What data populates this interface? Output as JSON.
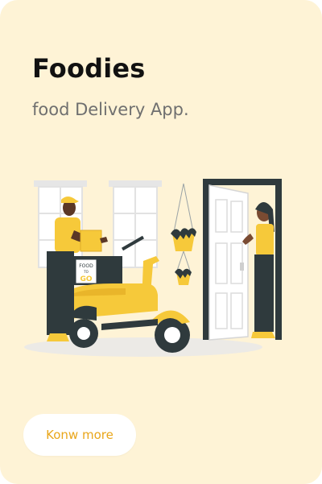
{
  "card": {
    "title": "Foodies",
    "subtitle": "food Delivery App.",
    "button_label": "Konw more",
    "illustration": {
      "box_text_top": "FOOD",
      "box_text_mid": "TO",
      "box_text_bottom": "GO"
    }
  },
  "colors": {
    "card_background": "#fef3d6",
    "accent_yellow": "#f6c93a",
    "button_text": "#e9a61a",
    "dark": "#2f3a3d"
  }
}
